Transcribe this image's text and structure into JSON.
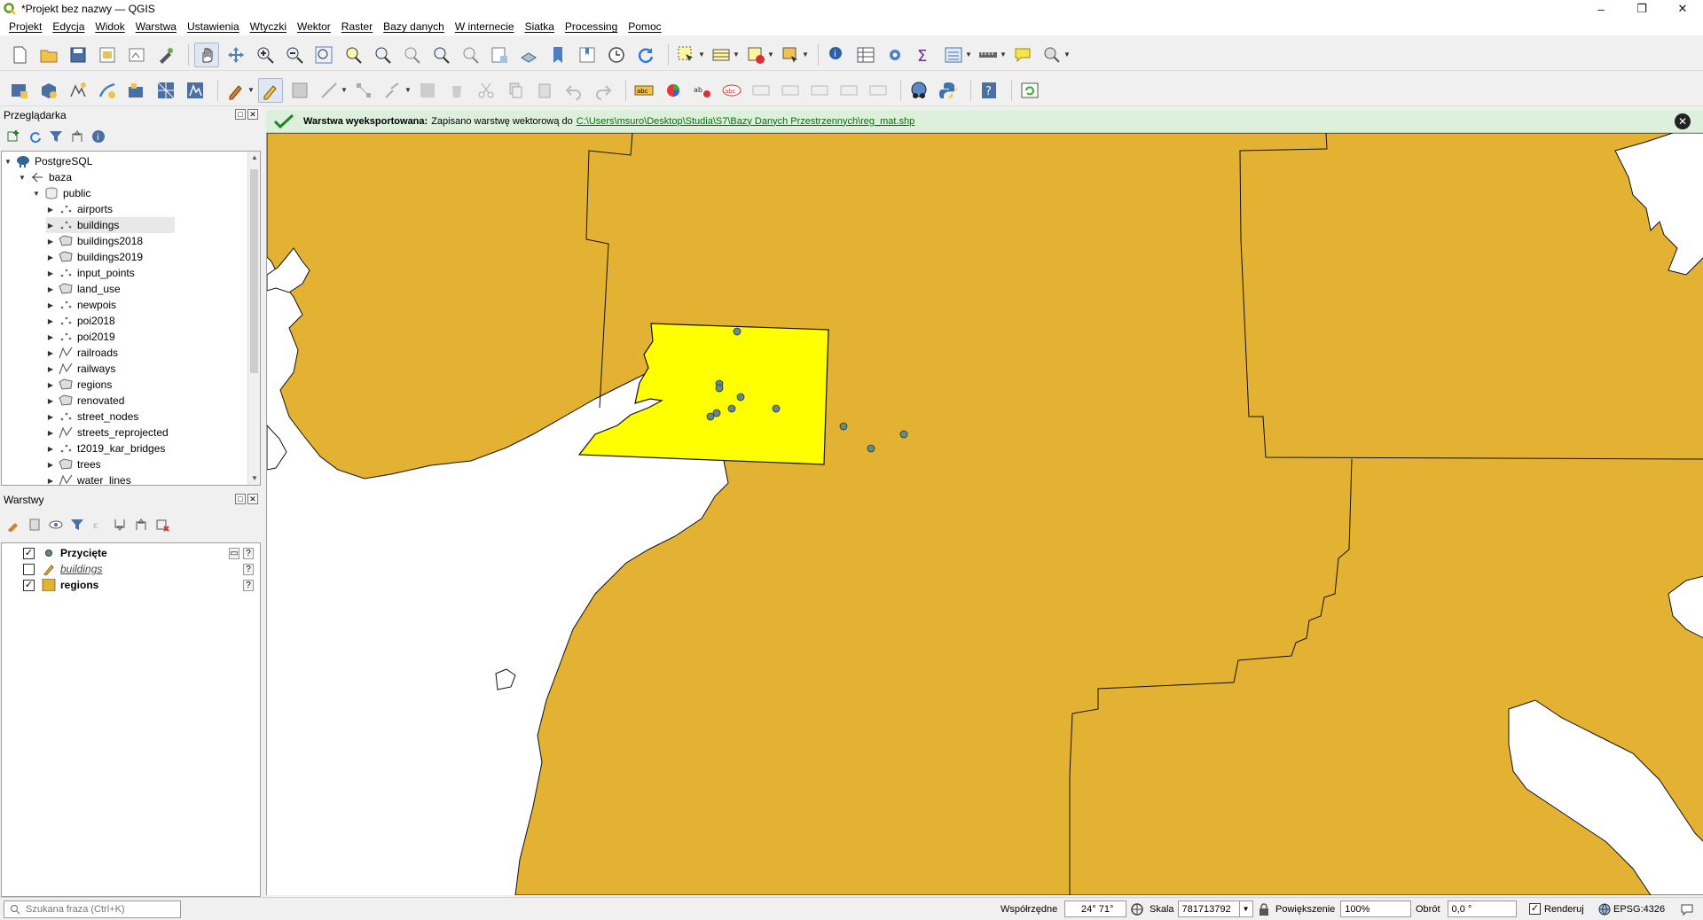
{
  "window": {
    "title": "*Projekt bez nazwy — QGIS",
    "minimize": "–",
    "maximize": "❐",
    "close": "✕"
  },
  "menu": {
    "items": [
      "Projekt",
      "Edycja",
      "Widok",
      "Warstwa",
      "Ustawienia",
      "Wtyczki",
      "Wektor",
      "Raster",
      "Bazy danych",
      "W internecie",
      "Siatka",
      "Processing",
      "Pomoc"
    ]
  },
  "browser": {
    "title": "Przeglądarka",
    "root": "PostgreSQL",
    "connection": "baza",
    "schema": "public",
    "tables": [
      {
        "name": "airports",
        "icon": "point-layer-icon"
      },
      {
        "name": "buildings",
        "icon": "point-layer-icon",
        "selected": true
      },
      {
        "name": "buildings2018",
        "icon": "polygon-layer-icon"
      },
      {
        "name": "buildings2019",
        "icon": "polygon-layer-icon"
      },
      {
        "name": "input_points",
        "icon": "point-layer-icon"
      },
      {
        "name": "land_use",
        "icon": "polygon-layer-icon"
      },
      {
        "name": "newpois",
        "icon": "point-layer-icon"
      },
      {
        "name": "poi2018",
        "icon": "point-layer-icon"
      },
      {
        "name": "poi2019",
        "icon": "point-layer-icon"
      },
      {
        "name": "railroads",
        "icon": "line-layer-icon"
      },
      {
        "name": "railways",
        "icon": "line-layer-icon"
      },
      {
        "name": "regions",
        "icon": "polygon-layer-icon"
      },
      {
        "name": "renovated",
        "icon": "polygon-layer-icon"
      },
      {
        "name": "street_nodes",
        "icon": "point-layer-icon"
      },
      {
        "name": "streets_reprojected",
        "icon": "line-layer-icon"
      },
      {
        "name": "t2019_kar_bridges",
        "icon": "point-layer-icon"
      },
      {
        "name": "trees",
        "icon": "polygon-layer-icon"
      },
      {
        "name": "water_lines",
        "icon": "line-layer-icon"
      }
    ]
  },
  "layers": {
    "title": "Warstwy",
    "items": [
      {
        "name": "Przycięte",
        "checked": true,
        "symbol": "point"
      },
      {
        "name": "buildings",
        "checked": false,
        "symbol": "edit",
        "italic": true
      },
      {
        "name": "regions",
        "checked": true,
        "symbol": "polygon"
      }
    ]
  },
  "message": {
    "title": "Warstwa wyeksportowana:",
    "text": "Zapisano warstwę wektorową do",
    "link": "C:\\Users\\msuro\\Desktop\\Studia\\S7\\Bazy Danych Przestrzennych\\reg_mat.shp"
  },
  "status": {
    "search_placeholder": "Szukana fraza (Ctrl+K)",
    "coords_label": "Współrzędne",
    "coords_value": "24° 71°",
    "scale_label": "Skala",
    "scale_value": "781713792",
    "magnifier_label": "Powiększenie",
    "magnifier_value": "100%",
    "rotation_label": "Obrót",
    "rotation_value": "0,0 °",
    "render_label": "Renderuj",
    "crs": "EPSG:4326"
  },
  "colors": {
    "land": "#e3b233",
    "selection": "#ffff00",
    "points": "#5f8b8b",
    "message_bg": "#dcf0dc"
  }
}
